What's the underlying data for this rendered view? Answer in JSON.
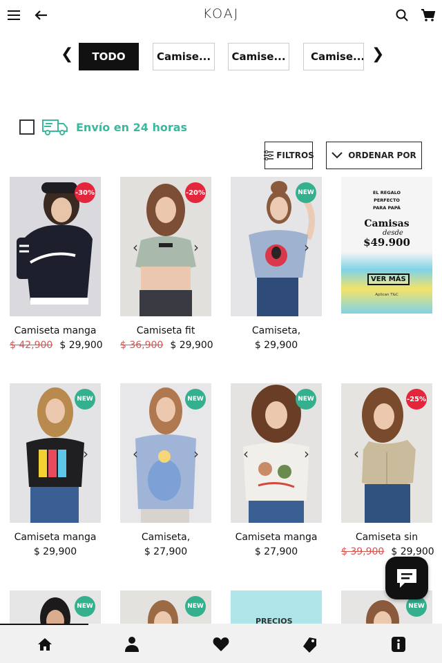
{
  "header": {
    "logo": "KOAJ",
    "icons": [
      "menu-icon",
      "back-arrow-icon",
      "search-icon",
      "cart-icon"
    ]
  },
  "categories": {
    "items": [
      {
        "label": "TODO",
        "active": true
      },
      {
        "label": "Camise..."
      },
      {
        "label": "Camise..."
      },
      {
        "label": "Camise..."
      }
    ],
    "prev_icon": "❮",
    "next_icon": "❯"
  },
  "shipping": {
    "label": "Envío en 24 horas",
    "checked": false
  },
  "toolbar": {
    "filters_label": "FILTROS",
    "sort_label": "ORDENAR POR"
  },
  "products": [
    {
      "name": "Camiseta manga",
      "old_price": "$ 42,900",
      "price": "$ 29,900",
      "badge": "-30%",
      "badge_type": "sale",
      "bg": "#d9d9de"
    },
    {
      "name": "Camiseta fit",
      "old_price": "$ 36,900",
      "price": "$ 29,900",
      "badge": "-20%",
      "badge_type": "sale",
      "bg": "#e2e0dc"
    },
    {
      "name": "Camiseta,",
      "old_price": "",
      "price": "$ 29,900",
      "badge": "NEW",
      "badge_type": "new",
      "bg": "#e5e5e8"
    },
    {
      "promo": true,
      "promo_lines": [
        "EL REGALO",
        "PERFECTO",
        "PARA PAPÁ"
      ],
      "promo_title": "Camisas",
      "promo_sub": "desde",
      "promo_price": "$49.900",
      "promo_cta": "VER MÁS",
      "promo_note": "Aplican T&C"
    },
    {
      "name": "Camiseta manga",
      "old_price": "",
      "price": "$ 29,900",
      "badge": "NEW",
      "badge_type": "new",
      "bg": "#e3e3e5"
    },
    {
      "name": "Camiseta,",
      "old_price": "",
      "price": "$ 27,900",
      "badge": "NEW",
      "badge_type": "new",
      "bg": "#e7e6e8"
    },
    {
      "name": "Camiseta manga",
      "old_price": "",
      "price": "$ 27,900",
      "badge": "NEW",
      "badge_type": "new",
      "bg": "#e4e3e1"
    },
    {
      "name": "Camiseta sin",
      "old_price": "$ 39,900",
      "price": "$ 29,900",
      "badge": "-25%",
      "badge_type": "sale",
      "bg": "#e6e4e1"
    },
    {
      "badge": "NEW",
      "badge_type": "new",
      "bg": "#e6e6e6"
    },
    {
      "badge": "NEW",
      "badge_type": "new",
      "bg": "#e4e2df"
    },
    {
      "promo2": true,
      "bg": "#aee5e8",
      "text": "PRECIOS"
    },
    {
      "badge": "NEW",
      "badge_type": "new",
      "bg": "#e6e5e3"
    }
  ],
  "bottom_nav": [
    "home-icon",
    "user-icon",
    "heart-icon",
    "tag-icon",
    "info-icon"
  ],
  "colors": {
    "accent": "#3bb79c",
    "sale": "#e3263b",
    "new": "#34b08e",
    "dark": "#111111"
  }
}
